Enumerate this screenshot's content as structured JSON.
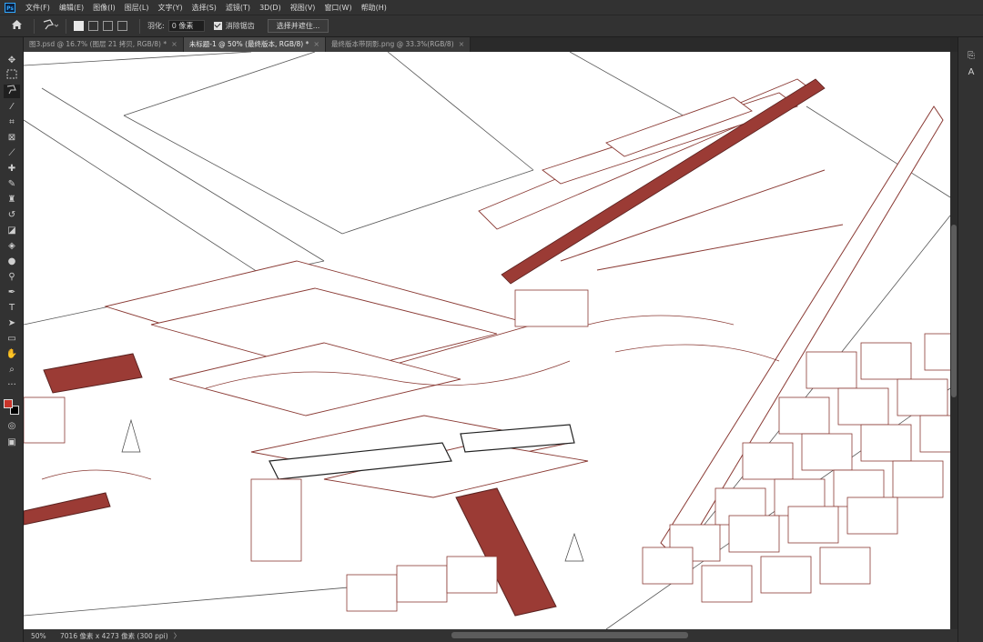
{
  "app": {
    "logo": "Ps"
  },
  "menu": [
    "文件(F)",
    "编辑(E)",
    "图像(I)",
    "图层(L)",
    "文字(Y)",
    "选择(S)",
    "滤镜(T)",
    "3D(D)",
    "视图(V)",
    "窗口(W)",
    "帮助(H)"
  ],
  "options": {
    "home_icon": "home-icon",
    "tool_icon": "polygonal-lasso-icon",
    "feather_label": "羽化:",
    "feather_value": "0 像素",
    "antialias_label": "消除锯齿",
    "antialias_checked": true,
    "select_mask_button": "选择并遮住..."
  },
  "tabs": [
    {
      "label": "图3.psd @ 16.7% (图层 21 拷贝, RGB/8) *",
      "active": false
    },
    {
      "label": "未标题-1 @ 50% (最终版本, RGB/8) *",
      "active": true
    },
    {
      "label": "最终版本带阴影.png @ 33.3%(RGB/8)",
      "active": false
    }
  ],
  "tab_close": "×",
  "tools": [
    "move-icon",
    "marquee-icon",
    "lasso-icon",
    "magic-wand-icon",
    "crop-icon",
    "frame-icon",
    "eyedropper-icon",
    "healing-icon",
    "brush-icon",
    "stamp-icon",
    "history-brush-icon",
    "eraser-icon",
    "paint-bucket-icon",
    "blur-icon",
    "dodge-icon",
    "pen-icon",
    "type-icon",
    "path-select-icon",
    "rectangle-icon",
    "hand-icon",
    "zoom-icon",
    "more-icon"
  ],
  "colors": {
    "foreground": "#c9342a",
    "background": "#000000",
    "accent_roof": "#9b3b35",
    "line": "#8a3a34"
  },
  "status": {
    "zoom": "50%",
    "doc_info": "7016 像素 x 4273 像素 (300 ppi)",
    "arrow": "〉"
  }
}
